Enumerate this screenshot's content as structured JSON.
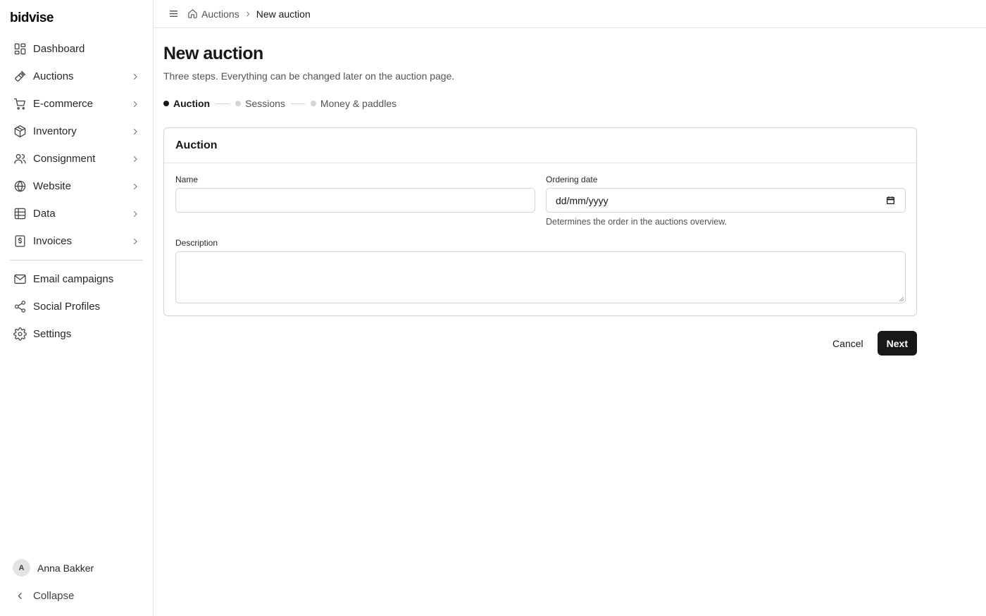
{
  "brand": "bidvise",
  "sidebar": {
    "items": [
      {
        "label": "Dashboard",
        "icon": "dashboard-icon",
        "has_children": false
      },
      {
        "label": "Auctions",
        "icon": "gavel-icon",
        "has_children": true
      },
      {
        "label": "E-commerce",
        "icon": "cart-icon",
        "has_children": true
      },
      {
        "label": "Inventory",
        "icon": "package-icon",
        "has_children": true
      },
      {
        "label": "Consignment",
        "icon": "users-icon",
        "has_children": true
      },
      {
        "label": "Website",
        "icon": "globe-icon",
        "has_children": true
      },
      {
        "label": "Data",
        "icon": "table-icon",
        "has_children": true
      },
      {
        "label": "Invoices",
        "icon": "invoice-icon",
        "has_children": true
      }
    ],
    "secondary": [
      {
        "label": "Email campaigns",
        "icon": "mail-icon"
      },
      {
        "label": "Social Profiles",
        "icon": "share-icon"
      },
      {
        "label": "Settings",
        "icon": "gear-icon"
      }
    ],
    "user": {
      "initial": "A",
      "name": "Anna Bakker"
    },
    "collapse_label": "Collapse"
  },
  "breadcrumb": {
    "parent": "Auctions",
    "current": "New auction"
  },
  "page": {
    "title": "New auction",
    "subtitle": "Three steps. Everything can be changed later on the auction page."
  },
  "steps": [
    {
      "label": "Auction",
      "active": true
    },
    {
      "label": "Sessions",
      "active": false
    },
    {
      "label": "Money & paddles",
      "active": false
    }
  ],
  "form": {
    "card_title": "Auction",
    "name_label": "Name",
    "name_value": "",
    "date_label": "Ordering date",
    "date_placeholder": "dd/mm/yyyy",
    "date_help": "Determines the order in the auctions overview.",
    "description_label": "Description",
    "description_value": ""
  },
  "actions": {
    "cancel": "Cancel",
    "next": "Next"
  }
}
